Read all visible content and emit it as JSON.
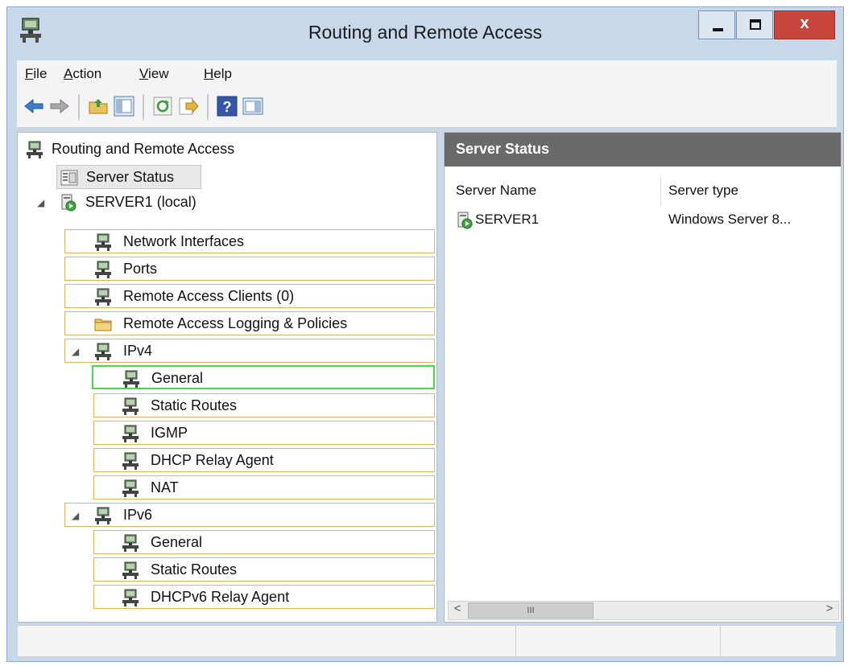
{
  "window": {
    "title": "Routing and Remote Access",
    "close_glyph": "x"
  },
  "menu": {
    "items": [
      {
        "key": "F",
        "rest": "ile"
      },
      {
        "key": "A",
        "rest": "ction"
      },
      {
        "key": "V",
        "rest": "iew"
      },
      {
        "key": "H",
        "rest": "elp"
      }
    ]
  },
  "toolbar": {
    "icons": [
      "back-arrow-icon",
      "forward-arrow-icon",
      "up-folder-icon",
      "show-hide-console-tree-icon",
      "refresh-icon",
      "export-list-icon",
      "help-icon",
      "show-hide-action-pane-icon"
    ]
  },
  "tree": {
    "root": "Routing and Remote Access",
    "server_status": "Server Status",
    "server": "SERVER1 (local)",
    "server_children": [
      "Network Interfaces",
      "Ports",
      "Remote Access Clients (0)",
      "Remote Access Logging & Policies"
    ],
    "ipv4": {
      "label": "IPv4",
      "children": [
        "General",
        "Static Routes",
        "IGMP",
        "DHCP Relay Agent",
        "NAT"
      ]
    },
    "ipv6": {
      "label": "IPv6",
      "children": [
        "General",
        "Static Routes",
        "DHCPv6 Relay Agent"
      ]
    }
  },
  "right_pane": {
    "header": "Server Status",
    "columns": [
      "Server Name",
      "Server type"
    ],
    "rows": [
      {
        "name": "SERVER1",
        "type": "Windows Server 8..."
      }
    ],
    "scroll_thumb_grip": "III",
    "scroll_left": "<",
    "scroll_right": ">"
  },
  "colors": {
    "selection_highlight": "#46d94a",
    "tree_item_border": "#e1b45a",
    "header_bg": "#6a6a6a",
    "close_button": "#c7453b"
  }
}
